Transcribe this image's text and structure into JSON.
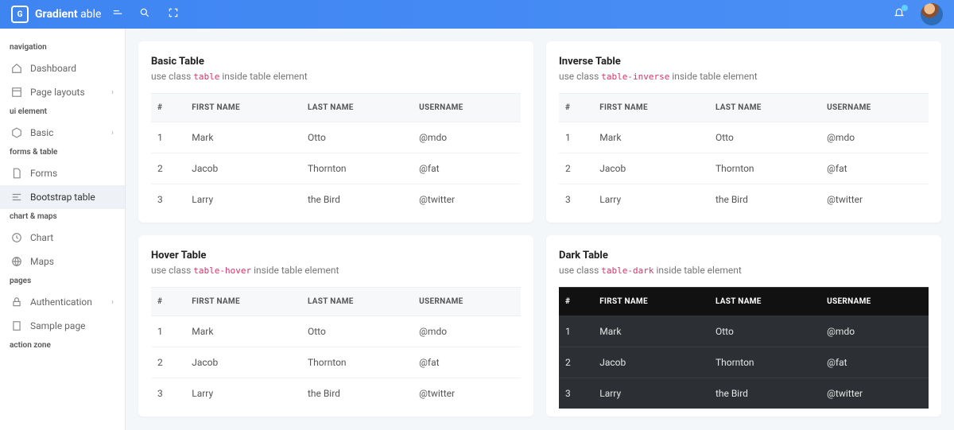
{
  "brand": {
    "bold": "Gradient",
    "light": " able"
  },
  "sidebar": {
    "sections": [
      {
        "title": "navigation",
        "items": [
          {
            "label": "Dashboard",
            "icon": "home-icon",
            "chev": false
          },
          {
            "label": "Page layouts",
            "icon": "layout-icon",
            "chev": true
          }
        ]
      },
      {
        "title": "ui element",
        "items": [
          {
            "label": "Basic",
            "icon": "box-icon",
            "chev": true
          }
        ]
      },
      {
        "title": "forms & table",
        "items": [
          {
            "label": "Forms",
            "icon": "file-icon",
            "chev": false
          },
          {
            "label": "Bootstrap table",
            "icon": "align-icon",
            "chev": false,
            "active": true
          }
        ]
      },
      {
        "title": "chart & maps",
        "items": [
          {
            "label": "Chart",
            "icon": "clock-icon",
            "chev": false
          },
          {
            "label": "Maps",
            "icon": "globe-icon",
            "chev": false
          }
        ]
      },
      {
        "title": "pages",
        "items": [
          {
            "label": "Authentication",
            "icon": "lock-icon",
            "chev": true
          },
          {
            "label": "Sample page",
            "icon": "page-icon",
            "chev": false
          }
        ]
      },
      {
        "title": "action zone",
        "items": []
      }
    ]
  },
  "tables": {
    "headers": [
      "#",
      "FIRST NAME",
      "LAST NAME",
      "USERNAME"
    ],
    "rows": [
      [
        "1",
        "Mark",
        "Otto",
        "@mdo"
      ],
      [
        "2",
        "Jacob",
        "Thornton",
        "@fat"
      ],
      [
        "3",
        "Larry",
        "the Bird",
        "@twitter"
      ]
    ],
    "cards": [
      {
        "title": "Basic Table",
        "sub_pre": "use class ",
        "sub_code": "table",
        "sub_post": " inside table element",
        "dark": false
      },
      {
        "title": "Inverse Table",
        "sub_pre": "use class ",
        "sub_code": "table-inverse",
        "sub_post": " inside table element",
        "dark": false
      },
      {
        "title": "Hover Table",
        "sub_pre": "use class ",
        "sub_code": "table-hover",
        "sub_post": " inside table element",
        "dark": false
      },
      {
        "title": "Dark Table",
        "sub_pre": "use class ",
        "sub_code": "table-dark",
        "sub_post": " inside table element",
        "dark": true
      }
    ]
  }
}
